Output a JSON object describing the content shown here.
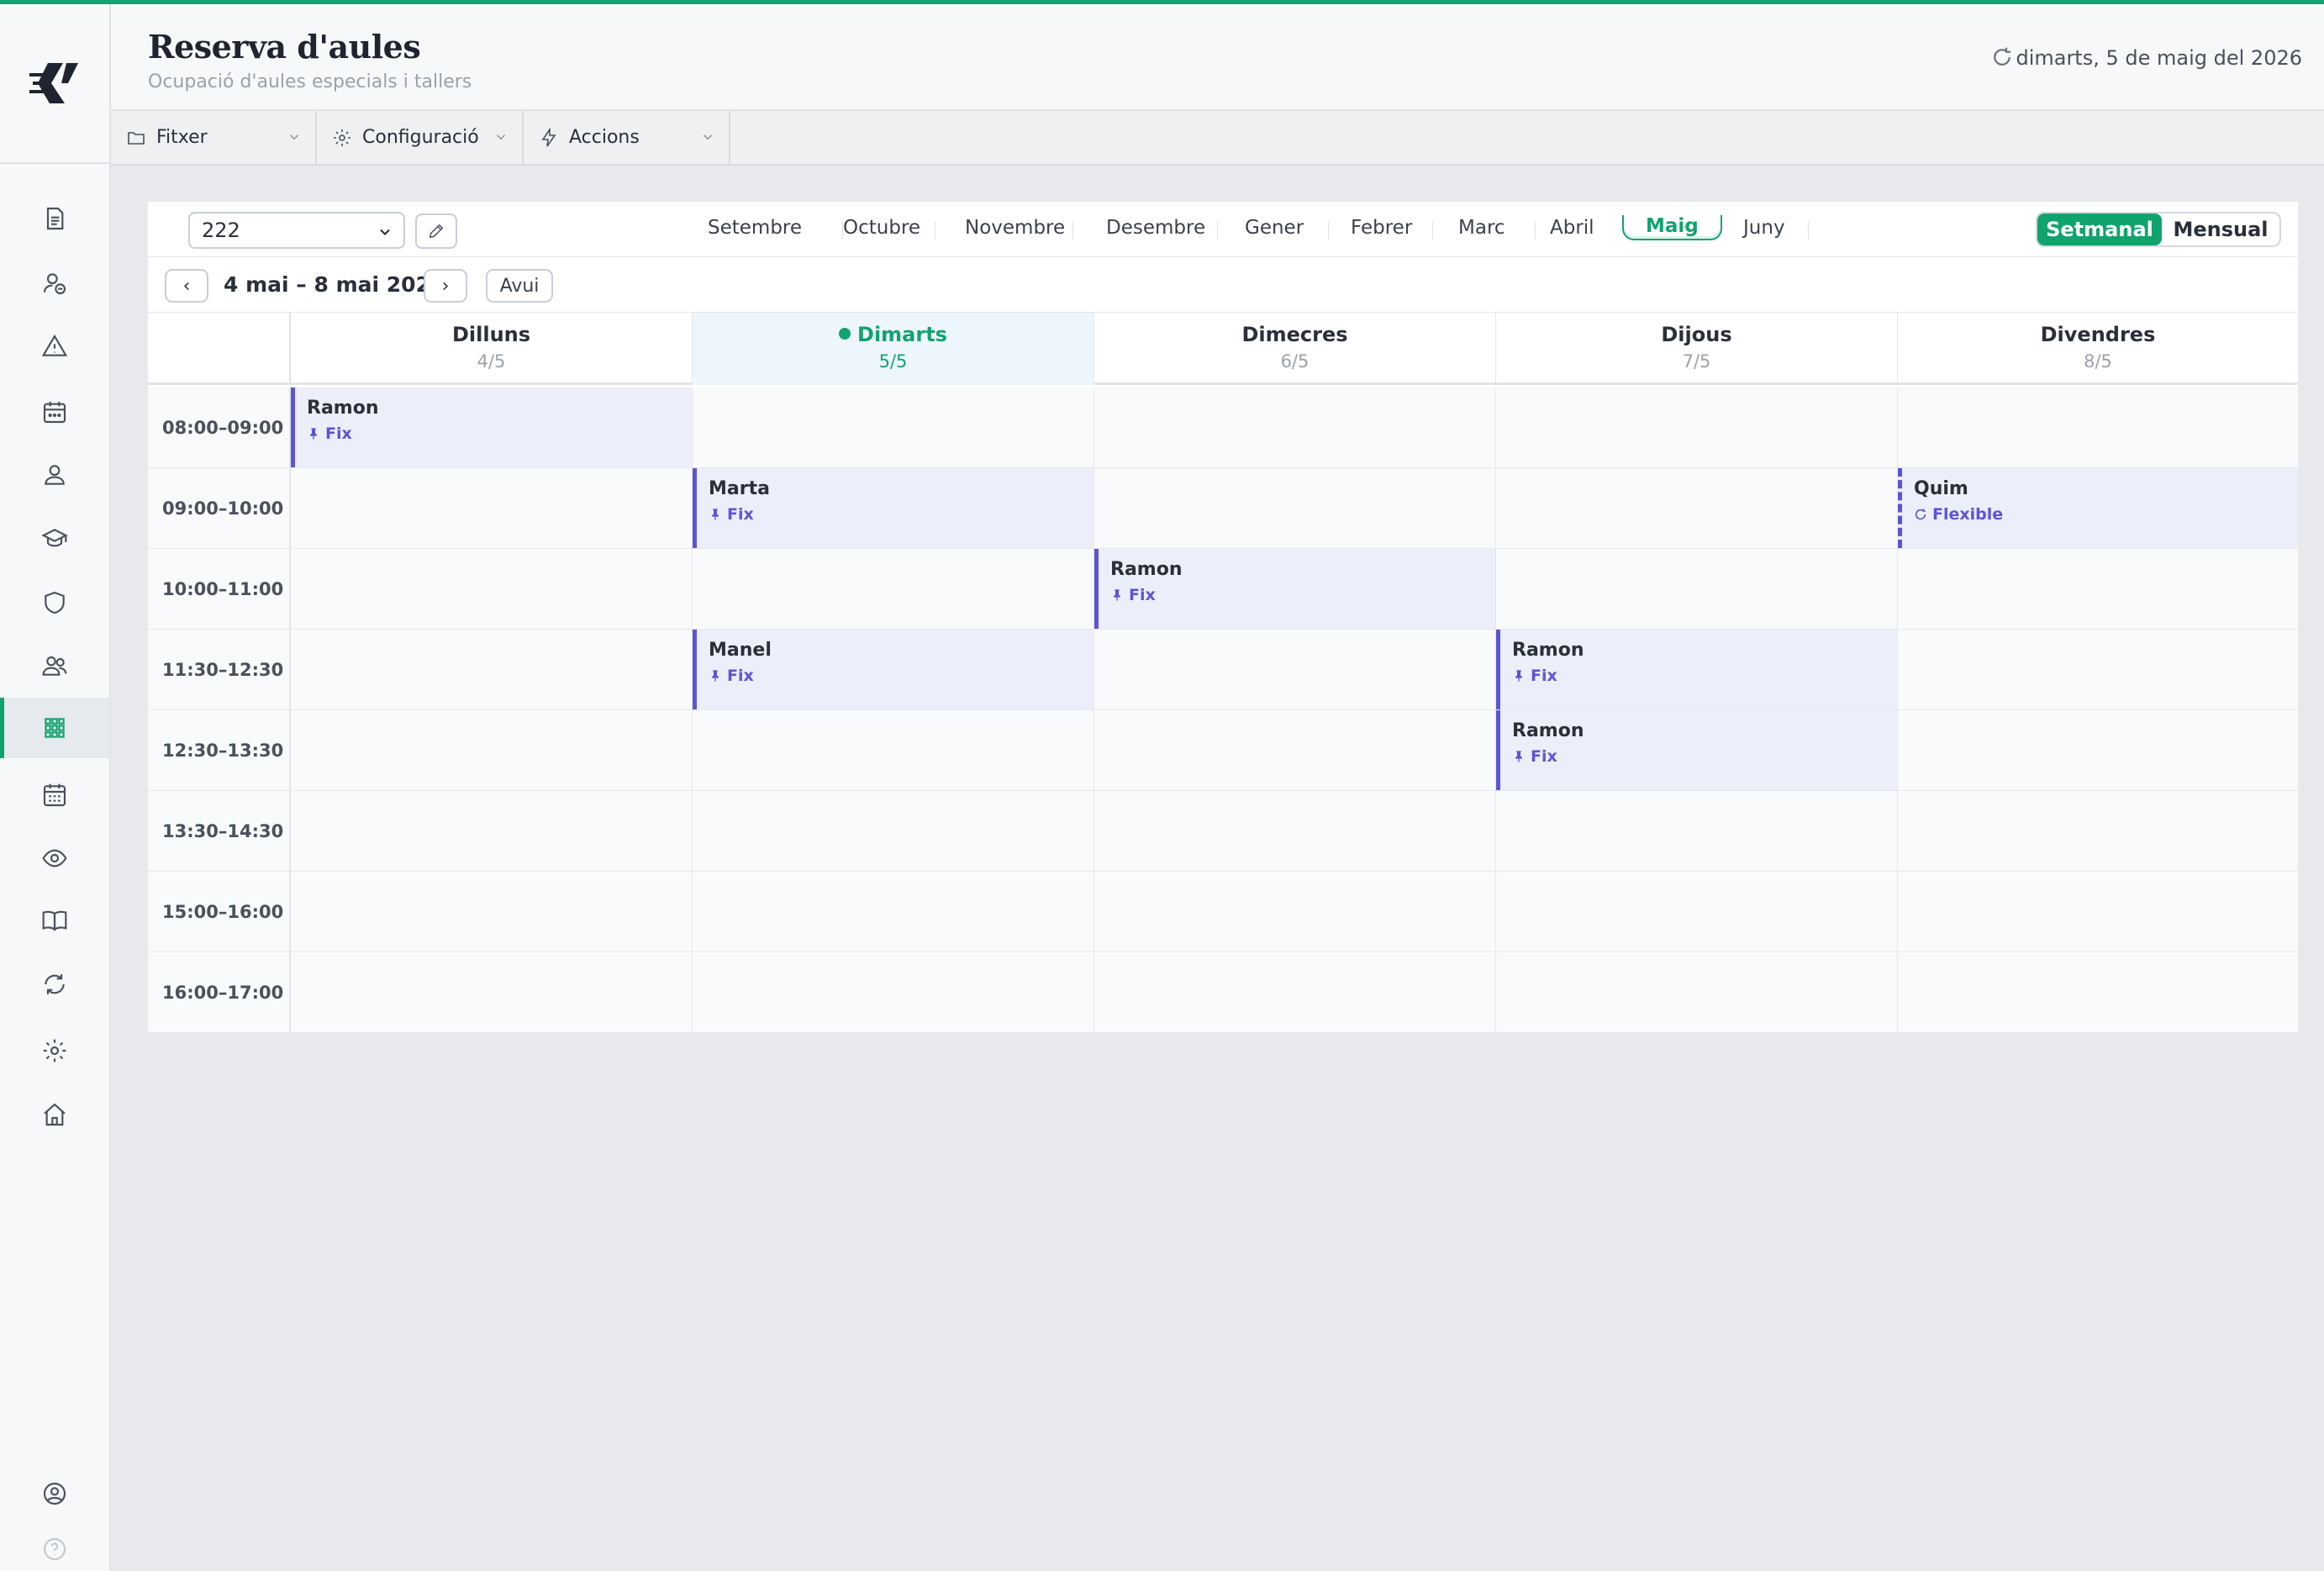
{
  "app": {
    "title": "Reserva d'aules",
    "subtitle": "Ocupació d'aules especials i tallers",
    "date": "dimarts, 5 de maig del 2026",
    "accent": "#11a36e",
    "booking_color": "#5b55d6"
  },
  "menubar": {
    "file_label": "Fitxer",
    "config_label": "Configuració",
    "actions_label": "Accions"
  },
  "sidebar": {
    "items": [
      "document-icon",
      "user-minus-icon",
      "warning-icon",
      "calendar-dots-icon",
      "user-icon",
      "graduation-cap-icon",
      "shield-icon",
      "users-icon",
      "grid-icon",
      "calendar-grid-icon",
      "eye-icon",
      "book-icon",
      "sync-icon",
      "gear-icon",
      "home-icon",
      "account-icon",
      "help-icon"
    ],
    "active": "grid-icon"
  },
  "toolbar": {
    "room_value": "222",
    "months": [
      "Setembre",
      "Octubre",
      "Novembre",
      "Desembre",
      "Gener",
      "Febrer",
      "Marc",
      "Abril",
      "Maig",
      "Juny"
    ],
    "active_month": "Maig",
    "view_weekly": "Setmanal",
    "view_monthly": "Mensual",
    "prev": "‹",
    "next": "›",
    "range": "4 mai – 8 mai 2026",
    "today": "Avui"
  },
  "days": [
    {
      "name": "Dilluns",
      "date": "4/5"
    },
    {
      "name": "Dimarts",
      "date": "5/5"
    },
    {
      "name": "Dimecres",
      "date": "6/5"
    },
    {
      "name": "Dijous",
      "date": "7/5"
    },
    {
      "name": "Divendres",
      "date": "8/5"
    }
  ],
  "slots": [
    "08:00–09:00",
    "09:00–10:00",
    "10:00–11:00",
    "11:30–12:30",
    "12:30–13:30",
    "13:30–14:30",
    "15:00–16:00",
    "16:00–17:00"
  ],
  "bookings": [
    {
      "slot": 0,
      "day": 0,
      "name": "Ramon",
      "type": "Fix"
    },
    {
      "slot": 1,
      "day": 1,
      "name": "Marta",
      "type": "Fix"
    },
    {
      "slot": 1,
      "day": 4,
      "name": "Quim",
      "type": "Flexible"
    },
    {
      "slot": 2,
      "day": 2,
      "name": "Ramon",
      "type": "Fix"
    },
    {
      "slot": 3,
      "day": 1,
      "name": "Manel",
      "type": "Fix"
    },
    {
      "slot": 3,
      "day": 3,
      "name": "Ramon",
      "type": "Fix"
    },
    {
      "slot": 4,
      "day": 3,
      "name": "Ramon",
      "type": "Fix"
    }
  ]
}
